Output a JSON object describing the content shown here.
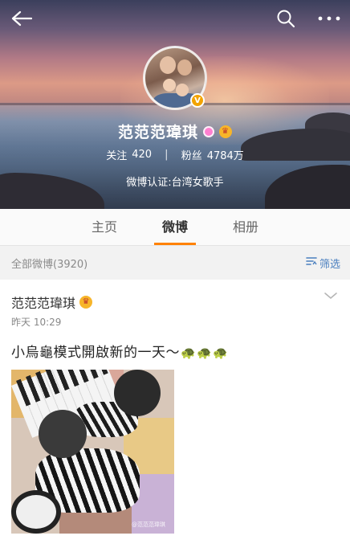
{
  "header": {
    "name": "范范范瑋琪",
    "follow_label": "关注",
    "follow_count": "420",
    "separator": "|",
    "fans_label": "粉丝",
    "fans_count": "4784万",
    "verification": "微博认证:台湾女歌手",
    "verified_mark": "V"
  },
  "tabs": [
    {
      "label": "主页",
      "active": false
    },
    {
      "label": "微博",
      "active": true
    },
    {
      "label": "相册",
      "active": false
    }
  ],
  "filter": {
    "count_text": "全部微博(3920)",
    "filter_label": "筛选"
  },
  "post": {
    "author": "范范范瑋琪",
    "time": "昨天 10:29",
    "text": "小烏龜模式開啟新的一天～",
    "emoji": [
      "🐢",
      "🐢",
      "🐢"
    ],
    "watermark": "@范范范瑋琪"
  },
  "colors": {
    "accent": "#ff8200",
    "link": "#4a7fbf",
    "badge": "#f2a300"
  },
  "icons": [
    "back-arrow-icon",
    "search-icon",
    "more-icon",
    "chevron-down-icon",
    "filter-icon",
    "crown-icon",
    "member-icon"
  ]
}
